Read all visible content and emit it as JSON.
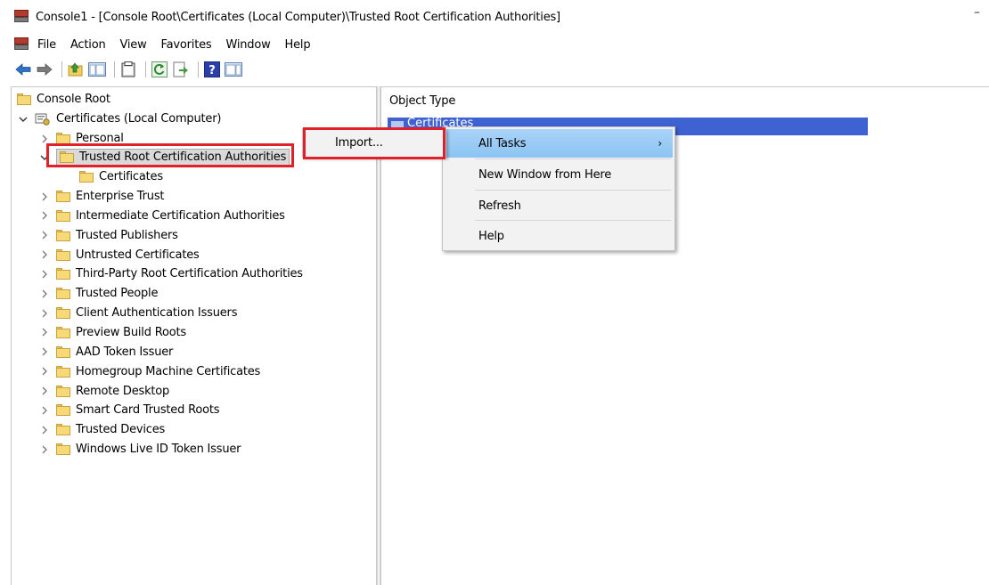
{
  "window": {
    "title": "Console1 - [Console Root\\Certificates (Local Computer)\\Trusted Root Certification Authorities]",
    "minimize_glyph": "–"
  },
  "menubar": {
    "items": [
      "File",
      "Action",
      "View",
      "Favorites",
      "Window",
      "Help"
    ]
  },
  "toolbar": {
    "buttons": [
      "back-icon",
      "forward-icon",
      "up-folder-icon",
      "show-hide-tree-icon",
      "clipboard-icon",
      "refresh-icon",
      "export-list-icon",
      "help-icon",
      "action-pane-icon"
    ]
  },
  "tree": {
    "root": "Console Root",
    "computer": "Certificates (Local Computer)",
    "personal": "Personal",
    "selected": "Trusted Root Certification Authorities",
    "selected_child": "Certificates",
    "stores": [
      "Enterprise Trust",
      "Intermediate Certification Authorities",
      "Trusted Publishers",
      "Untrusted Certificates",
      "Third-Party Root Certification Authorities",
      "Trusted People",
      "Client Authentication Issuers",
      "Preview Build Roots",
      "AAD Token Issuer",
      "Homegroup Machine Certificates",
      "Remote Desktop",
      "Smart Card Trusted Roots",
      "Trusted Devices",
      "Windows Live ID Token Issuer"
    ]
  },
  "list": {
    "column_header": "Object Type",
    "row_label": "Certificates"
  },
  "context_menu": {
    "all_tasks": "All Tasks",
    "submenu_arrow": "›",
    "new_window": "New Window from Here",
    "refresh": "Refresh",
    "help": "Help"
  },
  "submenu": {
    "import": "Import..."
  },
  "colors": {
    "highlight_red": "#e0202a",
    "selection_blue": "#3f62d3",
    "menu_hover": "#91c9f7"
  }
}
